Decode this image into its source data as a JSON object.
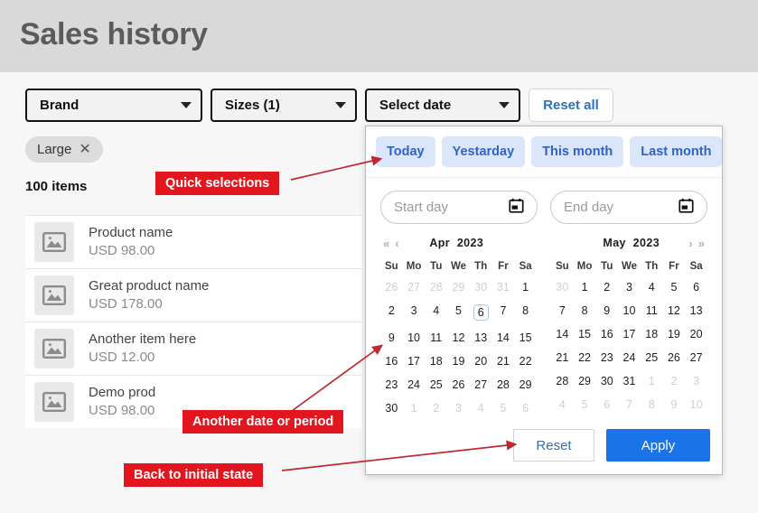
{
  "header": {
    "title": "Sales history"
  },
  "filters": {
    "brand": {
      "label": "Brand",
      "icon": "chevron-down-icon"
    },
    "sizes": {
      "label": "Sizes (1)",
      "icon": "chevron-down-icon"
    },
    "date": {
      "label": "Select date",
      "icon": "chevron-down-icon"
    },
    "reset_all": "Reset all",
    "chip": {
      "label": "Large",
      "remove_icon": "close-icon"
    },
    "items_count": "100 items"
  },
  "list": [
    {
      "name": "Product name",
      "price": "USD 98.00",
      "thumb_icon": "image-placeholder-icon"
    },
    {
      "name": "Great product name",
      "price": "USD 178.00",
      "thumb_icon": "image-placeholder-icon"
    },
    {
      "name": "Another item here",
      "price": "USD 12.00",
      "thumb_icon": "image-placeholder-icon"
    },
    {
      "name": "Demo prod",
      "price": "USD 98.00",
      "thumb_icon": "image-placeholder-icon"
    }
  ],
  "date_picker": {
    "quick_selections": [
      "Today",
      "Yestarday",
      "This month",
      "Last month"
    ],
    "start_input": {
      "placeholder": "Start day",
      "value": "",
      "icon": "calendar-icon"
    },
    "end_input": {
      "placeholder": "End day",
      "value": "",
      "icon": "calendar-icon"
    },
    "nav": {
      "prev_year": "«",
      "prev_month": "‹",
      "next_month": "›",
      "next_year": "»"
    },
    "weekdays": [
      "Su",
      "Mo",
      "Tu",
      "We",
      "Th",
      "Fr",
      "Sa"
    ],
    "months": [
      {
        "name": "Apr",
        "year": "2023",
        "weeks": [
          [
            {
              "d": "26",
              "m": true
            },
            {
              "d": "27",
              "m": true
            },
            {
              "d": "28",
              "m": true
            },
            {
              "d": "29",
              "m": true
            },
            {
              "d": "30",
              "m": true
            },
            {
              "d": "31",
              "m": true
            },
            {
              "d": "1"
            }
          ],
          [
            {
              "d": "2"
            },
            {
              "d": "3"
            },
            {
              "d": "4"
            },
            {
              "d": "5"
            },
            {
              "d": "6",
              "today": true
            },
            {
              "d": "7"
            },
            {
              "d": "8"
            }
          ],
          [
            {
              "d": "9"
            },
            {
              "d": "10"
            },
            {
              "d": "11"
            },
            {
              "d": "12"
            },
            {
              "d": "13"
            },
            {
              "d": "14"
            },
            {
              "d": "15"
            }
          ],
          [
            {
              "d": "16"
            },
            {
              "d": "17"
            },
            {
              "d": "18"
            },
            {
              "d": "19"
            },
            {
              "d": "20"
            },
            {
              "d": "21"
            },
            {
              "d": "22"
            }
          ],
          [
            {
              "d": "23"
            },
            {
              "d": "24"
            },
            {
              "d": "25"
            },
            {
              "d": "26"
            },
            {
              "d": "27"
            },
            {
              "d": "28"
            },
            {
              "d": "29"
            }
          ],
          [
            {
              "d": "30"
            },
            {
              "d": "1",
              "m": true
            },
            {
              "d": "2",
              "m": true
            },
            {
              "d": "3",
              "m": true
            },
            {
              "d": "4",
              "m": true
            },
            {
              "d": "5",
              "m": true
            },
            {
              "d": "6",
              "m": true
            }
          ]
        ]
      },
      {
        "name": "May",
        "year": "2023",
        "weeks": [
          [
            {
              "d": "30",
              "m": true
            },
            {
              "d": "1"
            },
            {
              "d": "2"
            },
            {
              "d": "3"
            },
            {
              "d": "4"
            },
            {
              "d": "5"
            },
            {
              "d": "6"
            }
          ],
          [
            {
              "d": "7"
            },
            {
              "d": "8"
            },
            {
              "d": "9"
            },
            {
              "d": "10"
            },
            {
              "d": "11"
            },
            {
              "d": "12"
            },
            {
              "d": "13"
            }
          ],
          [
            {
              "d": "14"
            },
            {
              "d": "15"
            },
            {
              "d": "16"
            },
            {
              "d": "17"
            },
            {
              "d": "18"
            },
            {
              "d": "19"
            },
            {
              "d": "20"
            }
          ],
          [
            {
              "d": "21"
            },
            {
              "d": "22"
            },
            {
              "d": "23"
            },
            {
              "d": "24"
            },
            {
              "d": "25"
            },
            {
              "d": "26"
            },
            {
              "d": "27"
            }
          ],
          [
            {
              "d": "28"
            },
            {
              "d": "29"
            },
            {
              "d": "30"
            },
            {
              "d": "31"
            },
            {
              "d": "1",
              "m": true
            },
            {
              "d": "2",
              "m": true
            },
            {
              "d": "3",
              "m": true
            }
          ],
          [
            {
              "d": "4",
              "m": true
            },
            {
              "d": "5",
              "m": true
            },
            {
              "d": "6",
              "m": true
            },
            {
              "d": "7",
              "m": true
            },
            {
              "d": "8",
              "m": true
            },
            {
              "d": "9",
              "m": true
            },
            {
              "d": "10",
              "m": true
            }
          ]
        ]
      }
    ],
    "reset_label": "Reset",
    "apply_label": "Apply"
  },
  "annotations": [
    {
      "id": "anno-quick",
      "text": "Quick selections"
    },
    {
      "id": "anno-period",
      "text": "Another date or period"
    },
    {
      "id": "anno-back",
      "text": "Back to initial state"
    }
  ],
  "colors": {
    "header_band": "#d9d9d9",
    "page_bg": "#f7f7f7",
    "accent_blue": "#1a73e8",
    "link_blue": "#2f6fb5",
    "quick_chip_bg": "#dce6fb",
    "quick_chip_text": "#2f63c6",
    "annotation_red": "#e3151f"
  }
}
